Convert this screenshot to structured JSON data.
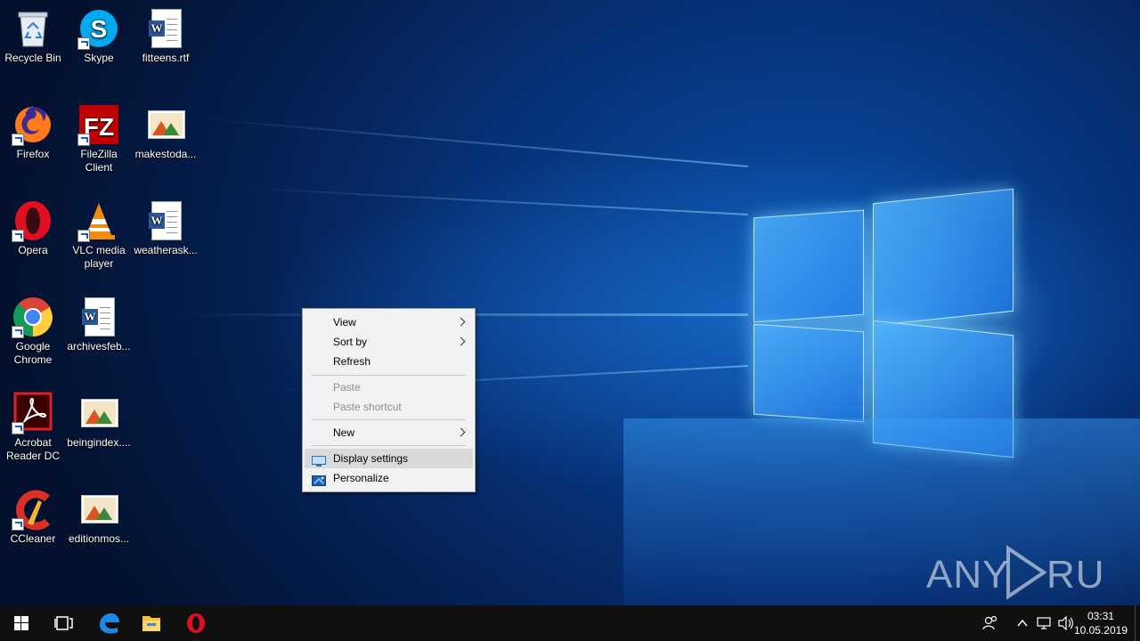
{
  "desktop_icons": [
    {
      "label": "Recycle Bin",
      "icon": "recycle-bin-icon"
    },
    {
      "label": "Skype",
      "icon": "skype-icon"
    },
    {
      "label": "fitteens.rtf",
      "icon": "word-document-icon"
    },
    {
      "label": "Firefox",
      "icon": "firefox-icon"
    },
    {
      "label": "FileZilla Client",
      "icon": "filezilla-icon"
    },
    {
      "label": "makestoda...",
      "icon": "image-file-icon"
    },
    {
      "label": "Opera",
      "icon": "opera-icon"
    },
    {
      "label": "VLC media player",
      "icon": "vlc-icon"
    },
    {
      "label": "weatherask...",
      "icon": "word-document-icon"
    },
    {
      "label": "Google Chrome",
      "icon": "chrome-icon"
    },
    {
      "label": "archivesfeb...",
      "icon": "word-document-icon"
    },
    {
      "label": "Acrobat Reader DC",
      "icon": "acrobat-icon"
    },
    {
      "label": "beingindex....",
      "icon": "image-file-icon"
    },
    {
      "label": "CCleaner",
      "icon": "ccleaner-icon"
    },
    {
      "label": "editionmos...",
      "icon": "image-file-icon"
    }
  ],
  "context_menu": {
    "view": "View",
    "sort_by": "Sort by",
    "refresh": "Refresh",
    "paste": "Paste",
    "paste_shortcut": "Paste shortcut",
    "new": "New",
    "display_settings": "Display settings",
    "personalize": "Personalize"
  },
  "taskbar": {
    "pinned": [
      "start-icon",
      "task-view-icon",
      "edge-icon",
      "file-explorer-icon",
      "opera-icon"
    ],
    "tray": [
      "people-icon",
      "chevron-up-icon",
      "network-icon",
      "volume-icon"
    ],
    "time": "03:31",
    "date": "10.05.2019"
  },
  "watermark": "ANY RUN",
  "colors": {
    "taskbar": "#101010",
    "menu_bg": "#f2f2f2",
    "menu_highlight": "#dadada",
    "accent": "#0078d7"
  }
}
